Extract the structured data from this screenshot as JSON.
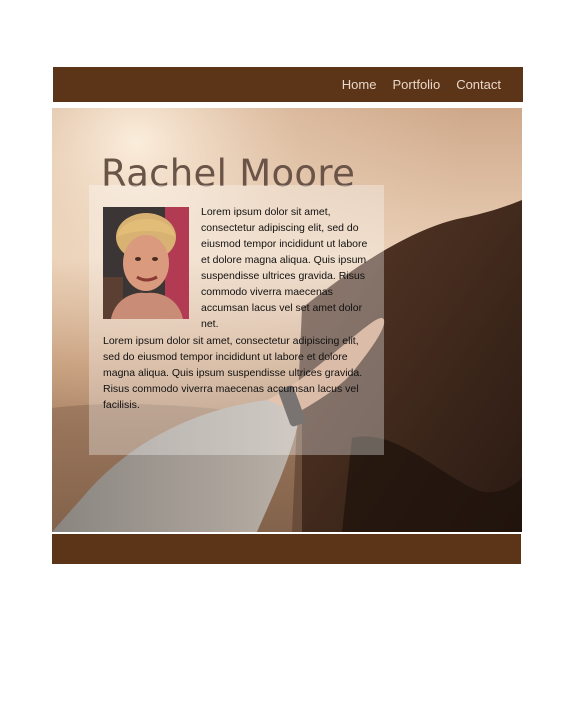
{
  "nav": {
    "home": "Home",
    "portfolio": "Portfolio",
    "contact": "Contact"
  },
  "colors": {
    "brand_brown": "#5c3418",
    "title_color": "#6a5448"
  },
  "hero": {
    "title": "Rachel Moore",
    "bio_paragraph_1": "Lorem ipsum dolor sit amet, consectetur adipiscing elit, sed do eiusmod tempor incididunt ut labore et dolore magna aliqua. Quis ipsum suspendisse ultrices gravida. Risus commodo viverra maecenas accumsan lacus vel set amet dolor net.",
    "bio_paragraph_2": "Lorem ipsum dolor sit amet, consectetur adipiscing elit, sed do eiusmod tempor incididunt ut labore et dolore magna aliqua. Quis ipsum suspendisse ultrices gravida. Risus commodo viverra maecenas accumsan lacus vel facilisis."
  }
}
